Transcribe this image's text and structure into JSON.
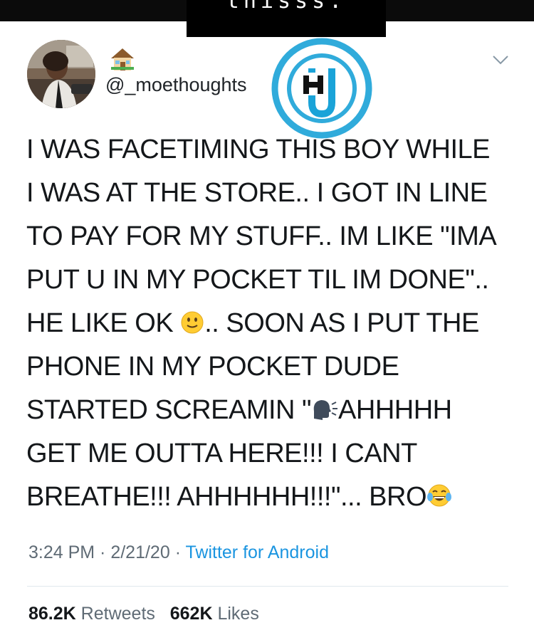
{
  "overlay": {
    "caption": "thisss."
  },
  "tweet": {
    "handle": "@_moethoughts",
    "icons": {
      "avatar": "profile-photo",
      "name_emoji": "house-emoji",
      "menu": "chevron-down-icon",
      "watermark": "HU-logo-watermark"
    },
    "lines": {
      "l1": "I WAS FACETIMING THIS BOY WHILE",
      "l2": "I WAS AT THE STORE.. I GOT IN LINE",
      "l3": "TO PAY FOR MY STUFF.. IM LIKE \"IMA",
      "l4": "PUT U IN MY POCKET TIL IM DONE\"..",
      "l5a": "HE LIKE OK ",
      "l5b": ".. SOON AS I PUT THE",
      "l6": "PHONE IN MY POCKET DUDE",
      "l7a": "STARTED SCREAMIN \"",
      "l7b": "AHHHHH",
      "l8": "GET ME OUTTA HERE!!! I CANT",
      "l9a": "BREATHE!!! AHHHHHH!!!\"... BRO"
    },
    "emojis": {
      "slight_smile": "slightly-smiling-face-emoji",
      "speaking_head": "speaking-head-emoji",
      "tears_of_joy": "face-with-tears-of-joy-emoji"
    },
    "meta": {
      "time": "3:24 PM",
      "sep1": " · ",
      "date": "2/21/20",
      "sep2": " · ",
      "source": "Twitter for Android"
    },
    "stats": {
      "retweets_count": "86.2K",
      "retweets_label": "Retweets",
      "likes_count": "662K",
      "likes_label": "Likes"
    }
  },
  "colors": {
    "text": "#14171a",
    "secondary": "#5f6b75",
    "link": "#1b95e0",
    "watermark": "#1aa3d8"
  }
}
